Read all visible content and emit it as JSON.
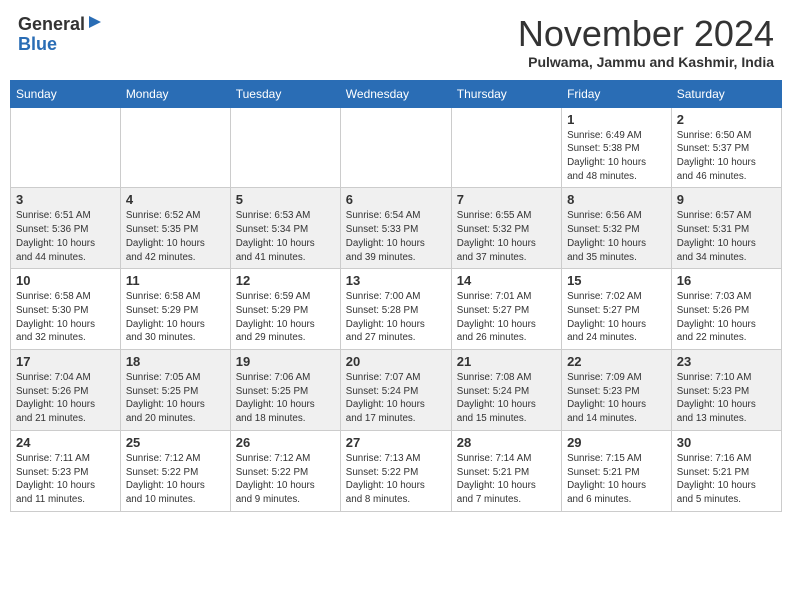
{
  "header": {
    "logo_general": "General",
    "logo_blue": "Blue",
    "month_title": "November 2024",
    "location": "Pulwama, Jammu and Kashmir, India"
  },
  "weekdays": [
    "Sunday",
    "Monday",
    "Tuesday",
    "Wednesday",
    "Thursday",
    "Friday",
    "Saturday"
  ],
  "weeks": [
    [
      {
        "day": "",
        "info": ""
      },
      {
        "day": "",
        "info": ""
      },
      {
        "day": "",
        "info": ""
      },
      {
        "day": "",
        "info": ""
      },
      {
        "day": "",
        "info": ""
      },
      {
        "day": "1",
        "info": "Sunrise: 6:49 AM\nSunset: 5:38 PM\nDaylight: 10 hours\nand 48 minutes."
      },
      {
        "day": "2",
        "info": "Sunrise: 6:50 AM\nSunset: 5:37 PM\nDaylight: 10 hours\nand 46 minutes."
      }
    ],
    [
      {
        "day": "3",
        "info": "Sunrise: 6:51 AM\nSunset: 5:36 PM\nDaylight: 10 hours\nand 44 minutes."
      },
      {
        "day": "4",
        "info": "Sunrise: 6:52 AM\nSunset: 5:35 PM\nDaylight: 10 hours\nand 42 minutes."
      },
      {
        "day": "5",
        "info": "Sunrise: 6:53 AM\nSunset: 5:34 PM\nDaylight: 10 hours\nand 41 minutes."
      },
      {
        "day": "6",
        "info": "Sunrise: 6:54 AM\nSunset: 5:33 PM\nDaylight: 10 hours\nand 39 minutes."
      },
      {
        "day": "7",
        "info": "Sunrise: 6:55 AM\nSunset: 5:32 PM\nDaylight: 10 hours\nand 37 minutes."
      },
      {
        "day": "8",
        "info": "Sunrise: 6:56 AM\nSunset: 5:32 PM\nDaylight: 10 hours\nand 35 minutes."
      },
      {
        "day": "9",
        "info": "Sunrise: 6:57 AM\nSunset: 5:31 PM\nDaylight: 10 hours\nand 34 minutes."
      }
    ],
    [
      {
        "day": "10",
        "info": "Sunrise: 6:58 AM\nSunset: 5:30 PM\nDaylight: 10 hours\nand 32 minutes."
      },
      {
        "day": "11",
        "info": "Sunrise: 6:58 AM\nSunset: 5:29 PM\nDaylight: 10 hours\nand 30 minutes."
      },
      {
        "day": "12",
        "info": "Sunrise: 6:59 AM\nSunset: 5:29 PM\nDaylight: 10 hours\nand 29 minutes."
      },
      {
        "day": "13",
        "info": "Sunrise: 7:00 AM\nSunset: 5:28 PM\nDaylight: 10 hours\nand 27 minutes."
      },
      {
        "day": "14",
        "info": "Sunrise: 7:01 AM\nSunset: 5:27 PM\nDaylight: 10 hours\nand 26 minutes."
      },
      {
        "day": "15",
        "info": "Sunrise: 7:02 AM\nSunset: 5:27 PM\nDaylight: 10 hours\nand 24 minutes."
      },
      {
        "day": "16",
        "info": "Sunrise: 7:03 AM\nSunset: 5:26 PM\nDaylight: 10 hours\nand 22 minutes."
      }
    ],
    [
      {
        "day": "17",
        "info": "Sunrise: 7:04 AM\nSunset: 5:26 PM\nDaylight: 10 hours\nand 21 minutes."
      },
      {
        "day": "18",
        "info": "Sunrise: 7:05 AM\nSunset: 5:25 PM\nDaylight: 10 hours\nand 20 minutes."
      },
      {
        "day": "19",
        "info": "Sunrise: 7:06 AM\nSunset: 5:25 PM\nDaylight: 10 hours\nand 18 minutes."
      },
      {
        "day": "20",
        "info": "Sunrise: 7:07 AM\nSunset: 5:24 PM\nDaylight: 10 hours\nand 17 minutes."
      },
      {
        "day": "21",
        "info": "Sunrise: 7:08 AM\nSunset: 5:24 PM\nDaylight: 10 hours\nand 15 minutes."
      },
      {
        "day": "22",
        "info": "Sunrise: 7:09 AM\nSunset: 5:23 PM\nDaylight: 10 hours\nand 14 minutes."
      },
      {
        "day": "23",
        "info": "Sunrise: 7:10 AM\nSunset: 5:23 PM\nDaylight: 10 hours\nand 13 minutes."
      }
    ],
    [
      {
        "day": "24",
        "info": "Sunrise: 7:11 AM\nSunset: 5:23 PM\nDaylight: 10 hours\nand 11 minutes."
      },
      {
        "day": "25",
        "info": "Sunrise: 7:12 AM\nSunset: 5:22 PM\nDaylight: 10 hours\nand 10 minutes."
      },
      {
        "day": "26",
        "info": "Sunrise: 7:12 AM\nSunset: 5:22 PM\nDaylight: 10 hours\nand 9 minutes."
      },
      {
        "day": "27",
        "info": "Sunrise: 7:13 AM\nSunset: 5:22 PM\nDaylight: 10 hours\nand 8 minutes."
      },
      {
        "day": "28",
        "info": "Sunrise: 7:14 AM\nSunset: 5:21 PM\nDaylight: 10 hours\nand 7 minutes."
      },
      {
        "day": "29",
        "info": "Sunrise: 7:15 AM\nSunset: 5:21 PM\nDaylight: 10 hours\nand 6 minutes."
      },
      {
        "day": "30",
        "info": "Sunrise: 7:16 AM\nSunset: 5:21 PM\nDaylight: 10 hours\nand 5 minutes."
      }
    ]
  ]
}
